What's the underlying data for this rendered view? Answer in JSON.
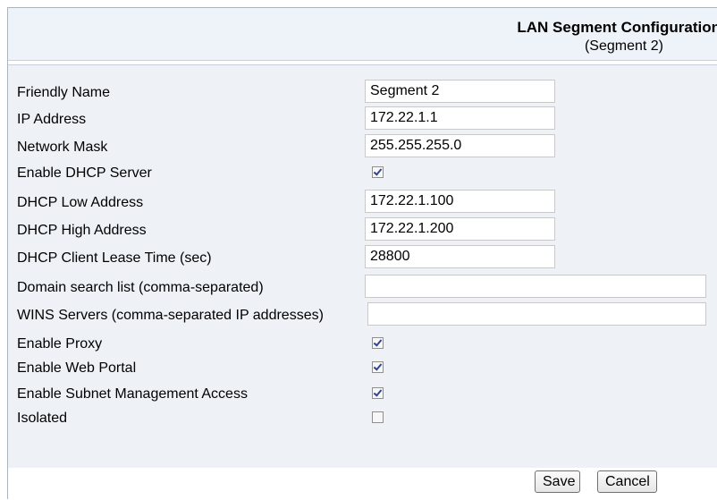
{
  "header": {
    "title": "LAN Segment Configuration",
    "subtitle": "(Segment 2)"
  },
  "fields": {
    "friendly_name": {
      "label": "Friendly Name",
      "value": "Segment 2"
    },
    "ip_address": {
      "label": "IP Address",
      "value": "172.22.1.1"
    },
    "network_mask": {
      "label": "Network Mask",
      "value": "255.255.255.0"
    },
    "enable_dhcp": {
      "label": "Enable DHCP Server",
      "checked": true
    },
    "dhcp_low": {
      "label": "DHCP Low Address",
      "value": "172.22.1.100"
    },
    "dhcp_high": {
      "label": "DHCP High Address",
      "value": "172.22.1.200"
    },
    "lease_time": {
      "label": "DHCP Client Lease Time (sec)",
      "value": "28800"
    },
    "domain_search": {
      "label": "Domain search list (comma-separated)",
      "value": ""
    },
    "wins_servers": {
      "label": "WINS Servers (comma-separated IP addresses)",
      "value": ""
    },
    "enable_proxy": {
      "label": "Enable Proxy",
      "checked": true
    },
    "enable_web_portal": {
      "label": "Enable Web Portal",
      "checked": true
    },
    "enable_subnet_mgmt": {
      "label": "Enable Subnet Management Access",
      "checked": true
    },
    "isolated": {
      "label": "Isolated",
      "checked": false
    }
  },
  "buttons": {
    "save_label": "Save",
    "cancel_label": "Cancel"
  },
  "colors": {
    "header_bg": "#eef3f9",
    "panel_bg": "#eef2f7",
    "checkmark": "#32448f"
  }
}
